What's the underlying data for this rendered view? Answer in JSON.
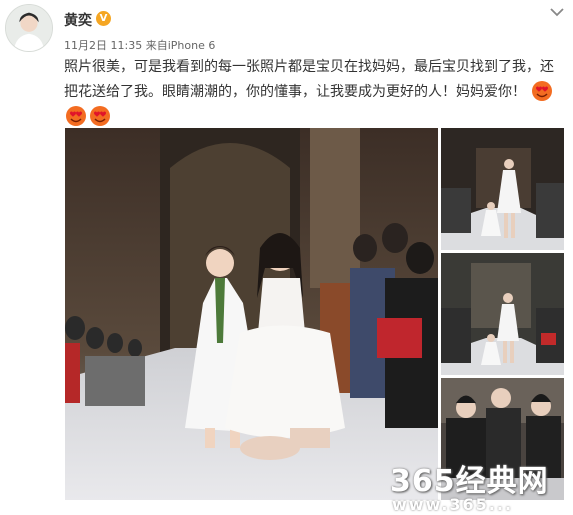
{
  "post": {
    "author": "黄奕",
    "verified_badge": "V",
    "date": "11月2日 11:35",
    "source_prefix": "来自",
    "source": "iPhone 6",
    "text_line1": "照片很美，可是我看到的每一张照片都是宝贝在找妈妈，最后宝贝找到了我，还",
    "text_line2": "把花送给了我。眼睛潮潮的，你的懂事，让我要成为更好的人！妈妈爱你！",
    "emoji_icon": "heart-eyes-emoji-icon",
    "menu_icon": "chevron-down-icon"
  },
  "photos": {
    "main_alt": "runway-mother-daughter-photo",
    "thumbs": [
      "runway-photo-1",
      "runway-photo-2",
      "runway-photo-3"
    ]
  },
  "watermark": {
    "brand": "365经典网",
    "url": "www.365..."
  },
  "colors": {
    "badge": "#f5a623",
    "text": "#333333",
    "meta": "#666666",
    "emoji": "#f36c21"
  }
}
